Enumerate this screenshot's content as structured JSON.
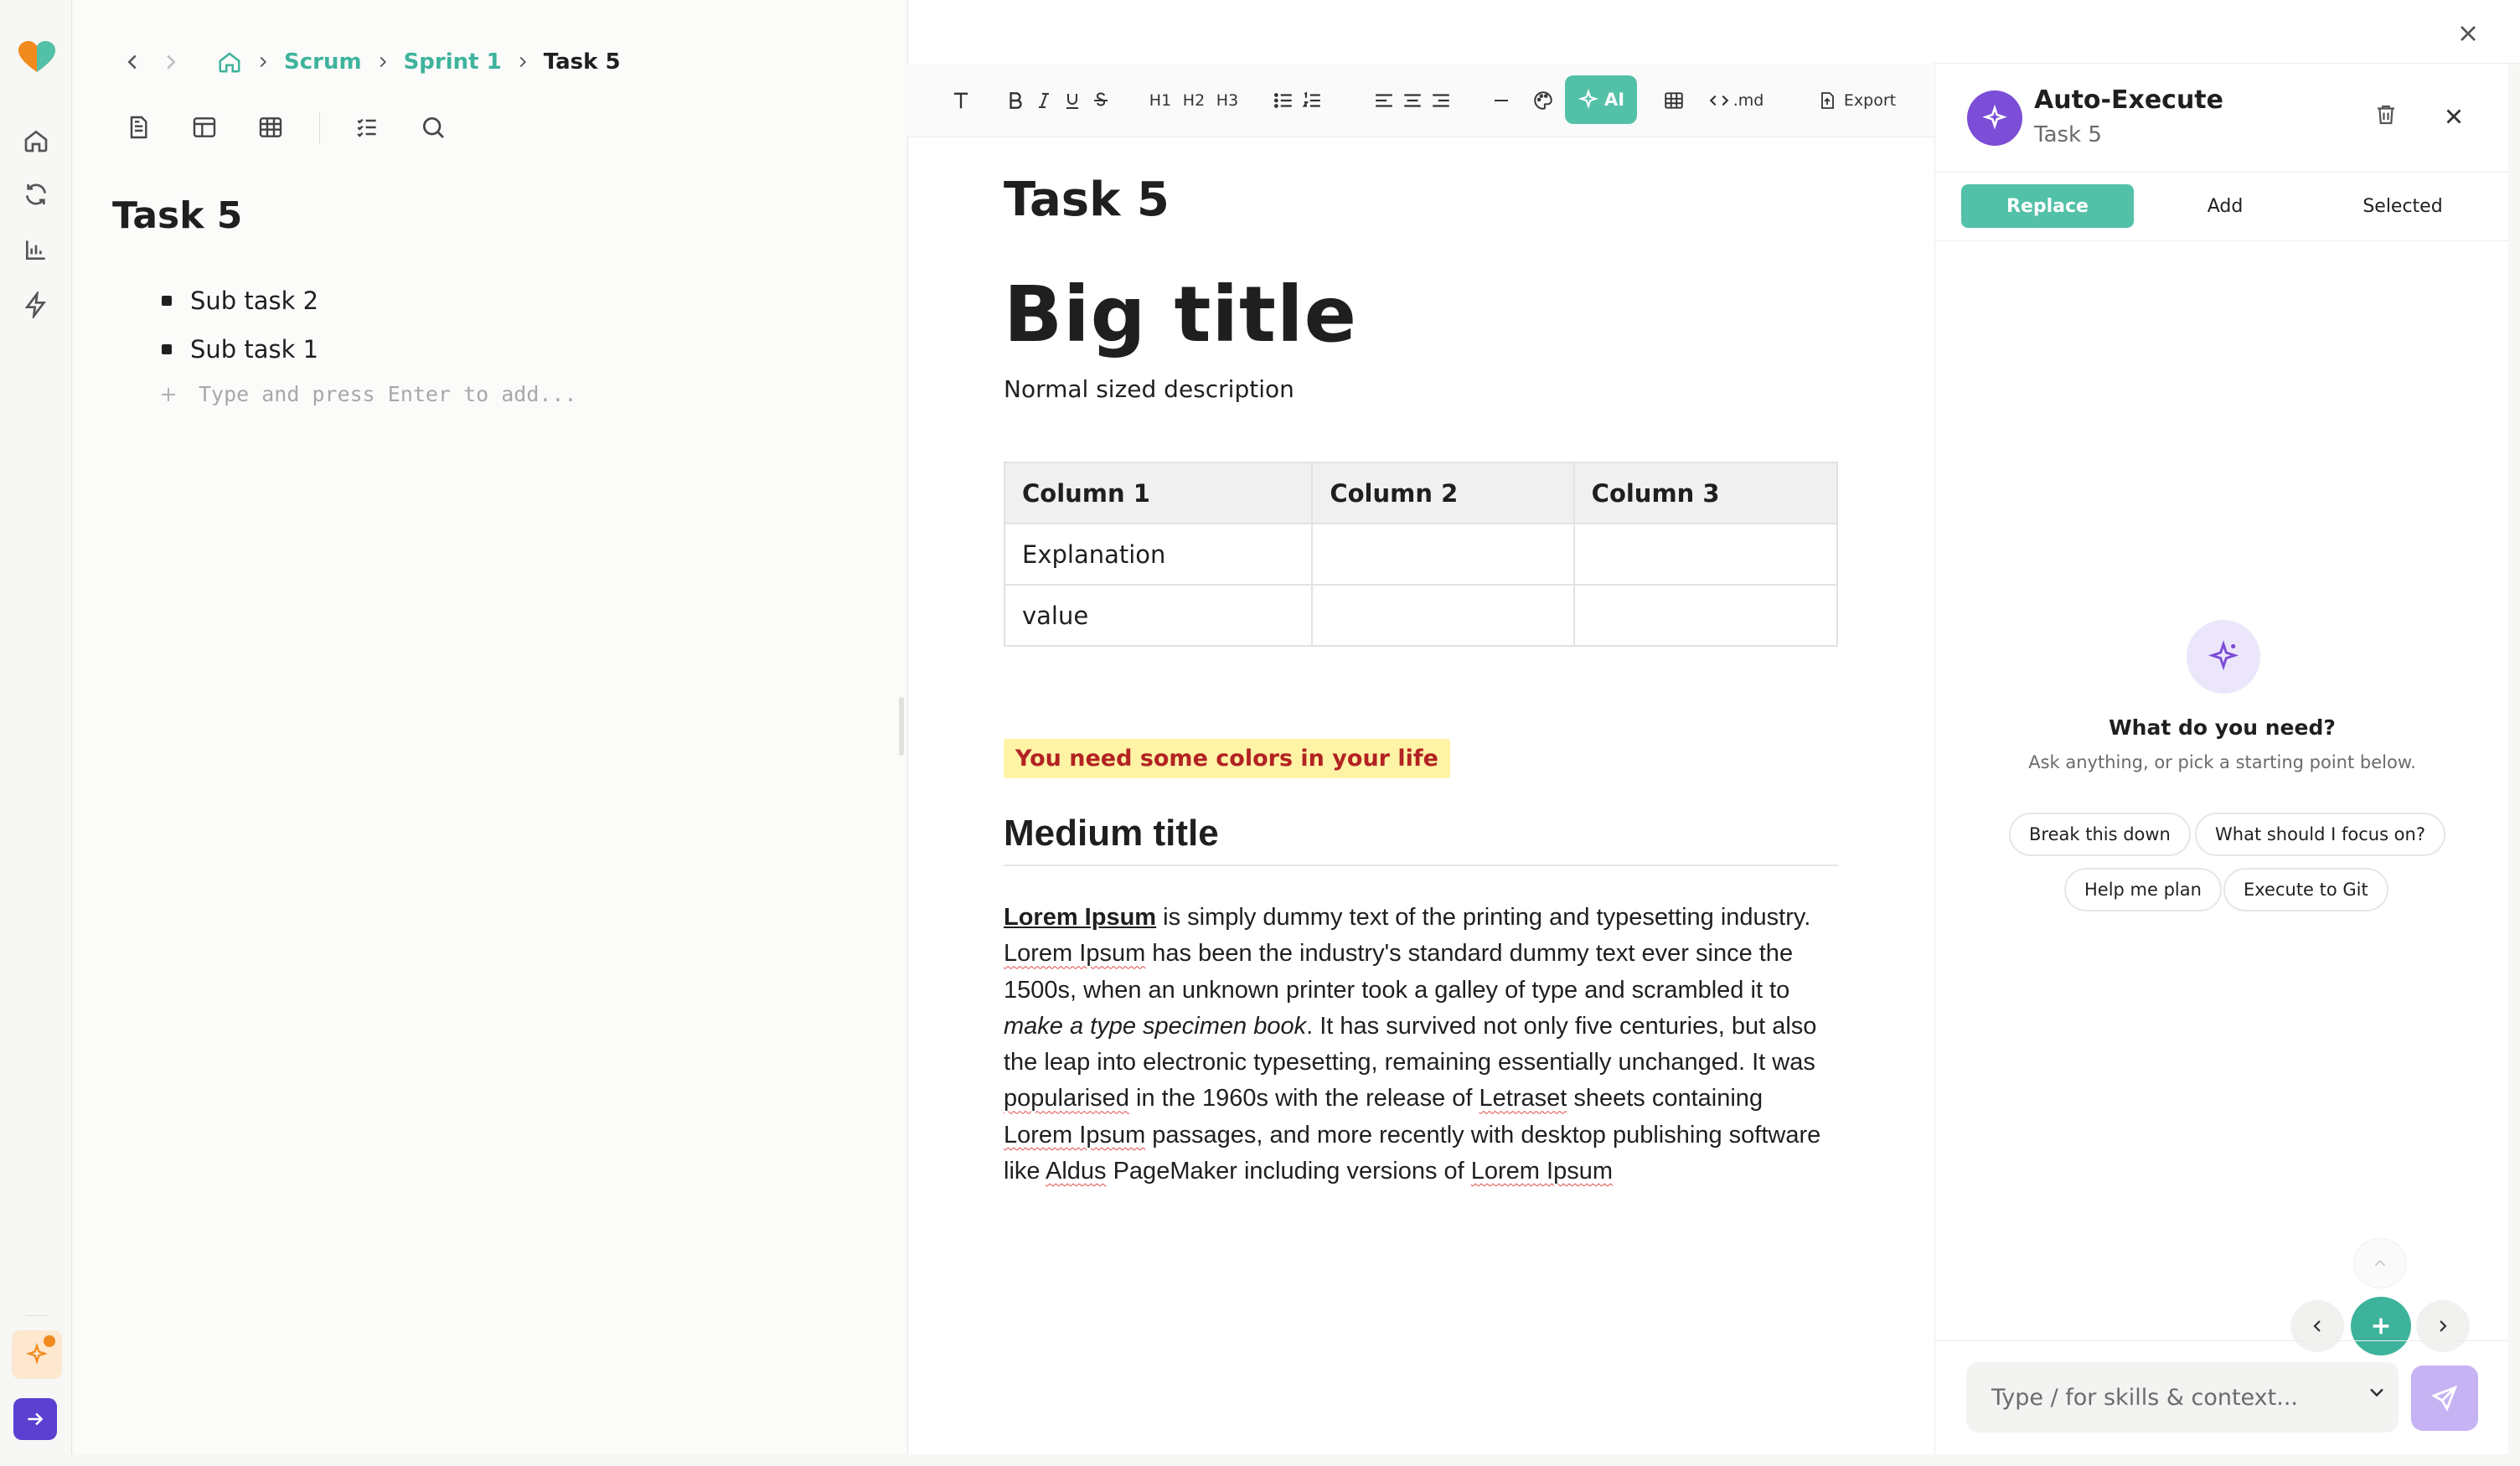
{
  "breadcrumb": {
    "items": [
      "Scrum",
      "Sprint 1"
    ],
    "current": "Task 5"
  },
  "left": {
    "title": "Task 5",
    "subtasks": [
      "Sub task 2",
      "Sub task 1"
    ],
    "add_placeholder": "Type and press Enter to add..."
  },
  "toolbar": {
    "ai_label": "AI",
    "md_label": ".md",
    "export_label": "Export",
    "h1": "H1",
    "h2": "H2",
    "h3": "H3"
  },
  "doc": {
    "title": "Task 5",
    "big_title": "Big title",
    "description": "Normal sized description",
    "table": {
      "headers": [
        "Column 1",
        "Column 2",
        "Column 3"
      ],
      "rows": [
        [
          "Explanation",
          "",
          ""
        ],
        [
          "value",
          "",
          ""
        ]
      ]
    },
    "highlight": "You need some colors in your life",
    "medium_title": "Medium title",
    "para": {
      "bold": "Lorem Ipsum",
      "t1": " is simply dummy text of the printing and typesetting industry. ",
      "sq1": "Lorem Ipsum",
      "t2": " has been the industry's standard dummy text ever since the 1500s, when an unknown printer took a galley of type and scrambled it to ",
      "italic": "make a type specimen book",
      "t3": ". It has survived not only five centuries, but also the leap into electronic typesetting, remaining essentially unchanged. It was ",
      "sq2": "popularised",
      "t4": " in the 1960s with the release of ",
      "sq3": "Letraset",
      "t5": " sheets containing ",
      "sq4": "Lorem Ipsum",
      "t6": " passages, and more recently with desktop publishing software like ",
      "sq5": "Aldus",
      "t7": " PageMaker including versions of ",
      "link": "Lorem Ipsum"
    }
  },
  "ai_panel": {
    "title": "Auto-Execute",
    "subtitle": "Task 5",
    "tabs": [
      "Replace",
      "Add",
      "Selected"
    ],
    "empty_title": "What do you need?",
    "empty_subtitle": "Ask anything, or pick a starting point below.",
    "chips": [
      "Break this down",
      "What should I focus on?",
      "Help me plan",
      "Execute to Git"
    ],
    "composer_placeholder": "Type / for skills & context..."
  },
  "colors": {
    "accent": "#53c0a8",
    "link": "#3eb39c",
    "purple": "#7c4dd6",
    "highlight_bg": "#fff3a6",
    "highlight_text": "#b32222"
  }
}
